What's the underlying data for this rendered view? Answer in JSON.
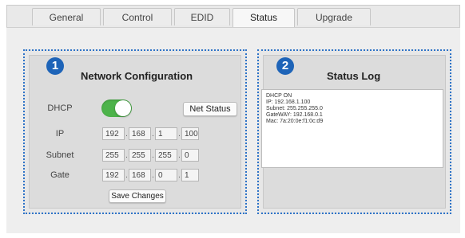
{
  "tabs": [
    {
      "label": "General"
    },
    {
      "label": "Control"
    },
    {
      "label": "EDID"
    },
    {
      "label": "Status",
      "active": true
    },
    {
      "label": "Upgrade"
    }
  ],
  "network": {
    "badge": "1",
    "title": "Network Configuration",
    "dhcp_label": "DHCP",
    "dhcp_enabled": true,
    "net_status_label": "Net Status",
    "ip_label": "IP",
    "ip": [
      "192",
      "168",
      "1",
      "100"
    ],
    "subnet_label": "Subnet",
    "subnet": [
      "255",
      "255",
      "255",
      "0"
    ],
    "gate_label": "Gate",
    "gate": [
      "192",
      "168",
      "0",
      "1"
    ],
    "save_label": "Save Changes"
  },
  "status_log": {
    "badge": "2",
    "title": "Status Log",
    "lines": [
      "DHCP ON",
      "IP: 192.168.1.100",
      "Subnet: 255.255.255.0",
      "GateWAY: 192.168.0.1",
      "Mac: 7a:20:0e:f1:0c:d9"
    ]
  },
  "colors": {
    "accent": "#2d73c8",
    "badge": "#1e64b8",
    "toggle_on": "#4db34a"
  }
}
